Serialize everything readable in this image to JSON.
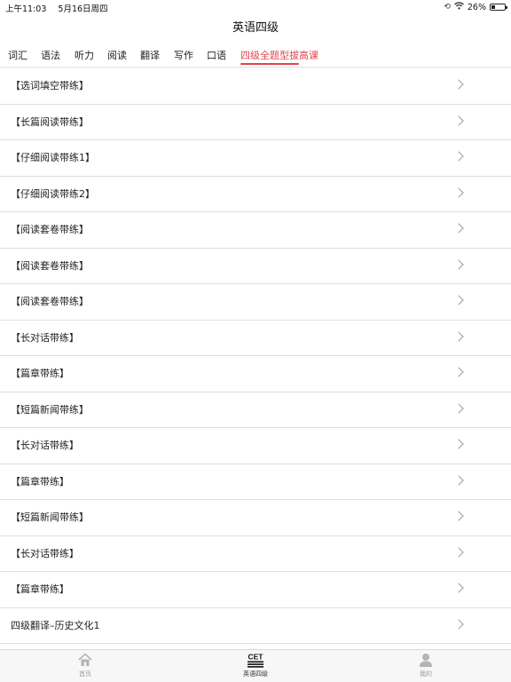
{
  "status_bar": {
    "time": "上午11:03",
    "date": "5月16日周四",
    "battery": "26%",
    "battery_level": 0.26
  },
  "nav": {
    "title": "英语四级"
  },
  "tabs": [
    {
      "label": "词汇",
      "active": false
    },
    {
      "label": "语法",
      "active": false
    },
    {
      "label": "听力",
      "active": false
    },
    {
      "label": "阅读",
      "active": false
    },
    {
      "label": "翻译",
      "active": false
    },
    {
      "label": "写作",
      "active": false
    },
    {
      "label": "口语",
      "active": false
    },
    {
      "label": "四级全题型拔高课",
      "active": true
    }
  ],
  "list": [
    {
      "label": "【选词填空带练】"
    },
    {
      "label": "【长篇阅读带练】"
    },
    {
      "label": "【仔细阅读带练1】"
    },
    {
      "label": "【仔细阅读带练2】"
    },
    {
      "label": "【阅读套卷带练】"
    },
    {
      "label": "【阅读套卷带练】"
    },
    {
      "label": "【阅读套卷带练】"
    },
    {
      "label": "【长对话带练】"
    },
    {
      "label": "【篇章带练】"
    },
    {
      "label": "【短篇新闻带练】"
    },
    {
      "label": "【长对话带练】"
    },
    {
      "label": "【篇章带练】"
    },
    {
      "label": "【短篇新闻带练】"
    },
    {
      "label": "【长对话带练】"
    },
    {
      "label": "【篇章带练】"
    },
    {
      "label": "四级翻译–历史文化1"
    }
  ],
  "tabbar": {
    "home": {
      "label": "首页",
      "icon": "home-icon"
    },
    "cet": {
      "label": "英语四级",
      "icon": "cet-icon",
      "icon_text": "CET"
    },
    "me": {
      "label": "我的",
      "icon": "person-icon"
    }
  },
  "colors": {
    "accent": "#e2454f",
    "divider": "#dedede"
  }
}
